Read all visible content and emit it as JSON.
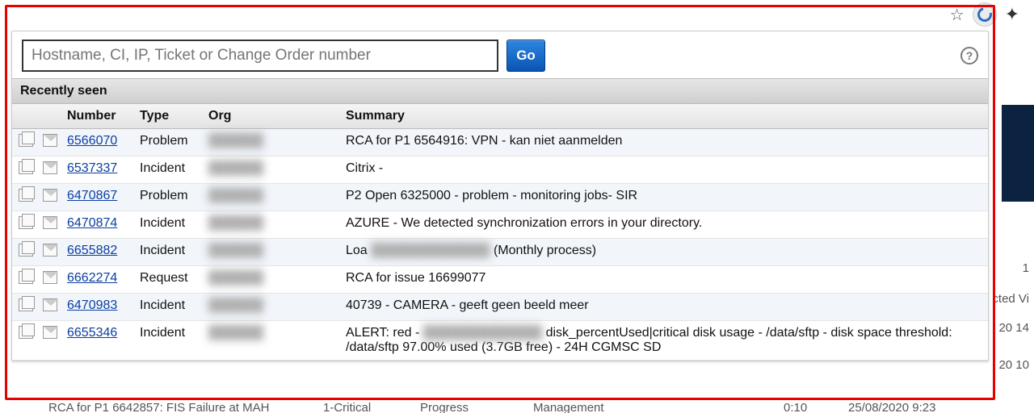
{
  "browser": {
    "star_tooltip": "Bookmark this page",
    "extension_name": "swirl-extension",
    "extensions_menu": "Extensions"
  },
  "search": {
    "placeholder": "Hostname, CI, IP, Ticket or Change Order number",
    "go_label": "Go",
    "help_label": "?"
  },
  "section_title": "Recently seen",
  "columns": {
    "number": "Number",
    "type": "Type",
    "org": "Org",
    "summary": "Summary"
  },
  "rows": [
    {
      "number": "6566070",
      "type": "Problem",
      "org": "",
      "summary": "RCA for P1 6564916: VPN - kan niet aanmelden"
    },
    {
      "number": "6537337",
      "type": "Incident",
      "org": "",
      "summary": "Citrix -"
    },
    {
      "number": "6470867",
      "type": "Problem",
      "org": "",
      "summary": "P2 Open 6325000 - problem - monitoring jobs- SIR"
    },
    {
      "number": "6470874",
      "type": "Incident",
      "org": "",
      "summary": "AZURE - We detected synchronization errors in your directory."
    },
    {
      "number": "6655882",
      "type": "Incident",
      "org": "",
      "summary_pre": "Loa",
      "summary_post": "(Monthly process)"
    },
    {
      "number": "6662274",
      "type": "Request",
      "org": "",
      "summary": "RCA for issue 16699077"
    },
    {
      "number": "6470983",
      "type": "Incident",
      "org": "",
      "summary": "40739 - CAMERA - geeft geen beeld meer"
    },
    {
      "number": "6655346",
      "type": "Incident",
      "org": "",
      "summary_pre": "ALERT: red -",
      "summary_post": "disk_percentUsed|critical disk usage - /data/sftp - disk space threshold: /data/sftp 97.00% used (3.7GB free) - 24H CGMSC SD"
    }
  ],
  "background": {
    "row_text": "RCA for P1 6642857: FIS Failure at MAH",
    "priority": "1-Critical",
    "progress": "Progress",
    "management": "Management",
    "time1": "0:10",
    "date1": "25/08/2020 9:23",
    "cted_vi": "cted Vi",
    "d1": "20 14",
    "d2": "20 10",
    "one": "1"
  }
}
